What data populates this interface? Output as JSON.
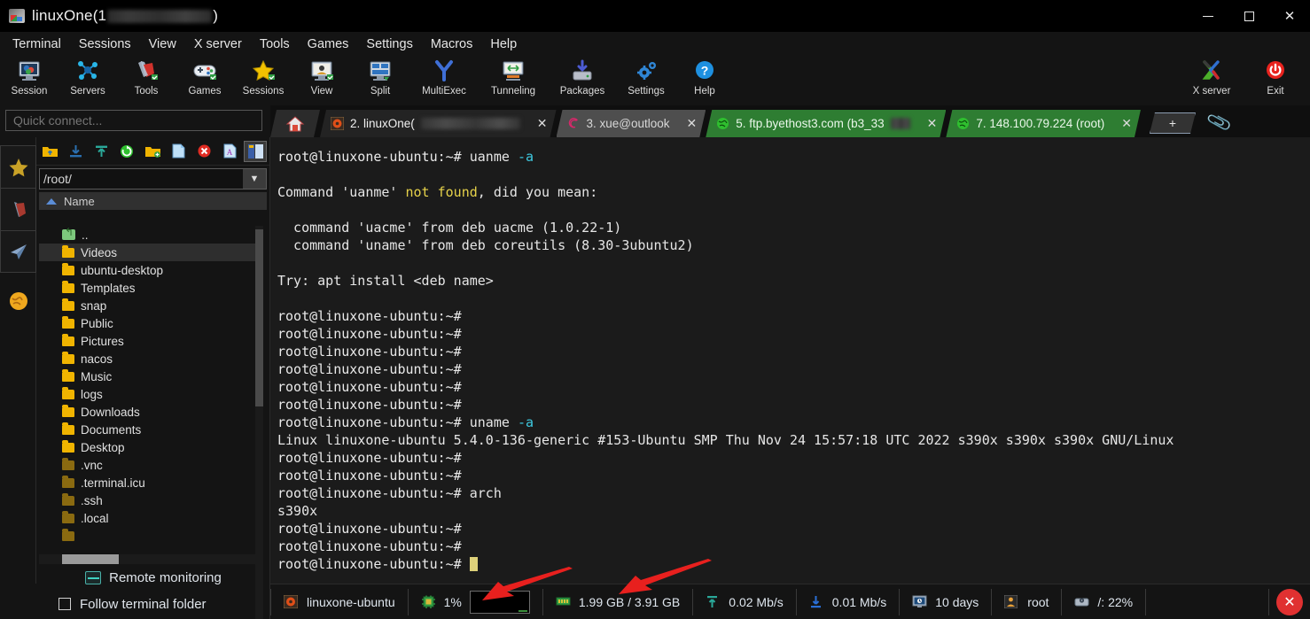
{
  "window": {
    "title_prefix": "linuxOne(1",
    "title_suffix": ")",
    "controls": {
      "minimize": "–",
      "maximize": "□",
      "close": "✕"
    }
  },
  "menubar": [
    {
      "label": "Terminal"
    },
    {
      "label": "Sessions"
    },
    {
      "label": "View"
    },
    {
      "label": "X server"
    },
    {
      "label": "Tools"
    },
    {
      "label": "Games"
    },
    {
      "label": "Settings"
    },
    {
      "label": "Macros"
    },
    {
      "label": "Help"
    }
  ],
  "toolbar": {
    "left": [
      {
        "label": "Session",
        "icon": "session-icon"
      },
      {
        "label": "Servers",
        "icon": "servers-icon"
      },
      {
        "label": "Tools",
        "icon": "swiss-knife-icon"
      },
      {
        "label": "Games",
        "icon": "gamepad-icon"
      },
      {
        "label": "Sessions",
        "icon": "star-icon"
      },
      {
        "label": "View",
        "icon": "monitor-user-icon"
      },
      {
        "label": "Split",
        "icon": "split-icon"
      },
      {
        "label": "MultiExec",
        "icon": "multiexec-icon"
      },
      {
        "label": "Tunneling",
        "icon": "tunneling-icon"
      },
      {
        "label": "Packages",
        "icon": "packages-icon"
      },
      {
        "label": "Settings",
        "icon": "gear-icon"
      },
      {
        "label": "Help",
        "icon": "help-icon"
      }
    ],
    "right": [
      {
        "label": "X server",
        "icon": "xserver-icon"
      },
      {
        "label": "Exit",
        "icon": "power-icon"
      }
    ]
  },
  "quick_connect": {
    "placeholder": "Quick connect..."
  },
  "tabs": [
    {
      "id": "home",
      "label": "",
      "icon": "home-icon",
      "state": "home",
      "closable": false
    },
    {
      "id": "t2",
      "label": "2. linuxOne(",
      "state": "active",
      "icon": "ubuntu-icon",
      "closable": true,
      "redacted": true
    },
    {
      "id": "t3",
      "label": "3. xue@outlook",
      "state": "inactive",
      "icon": "debian-icon",
      "closable": true,
      "redacted": false
    },
    {
      "id": "t5",
      "label": "5. ftp.byethost3.com (b3_33",
      "state": "green",
      "icon": "globe-icon",
      "closable": true,
      "redacted": true
    },
    {
      "id": "t7",
      "label": "7. 148.100.79.224  (root)",
      "state": "green",
      "icon": "globe-icon",
      "closable": true,
      "redacted": false
    }
  ],
  "new_tab_label": "+",
  "left_sidebar": [
    {
      "name": "sidebar-star",
      "icon": "star-icon"
    },
    {
      "name": "sidebar-tools",
      "icon": "swiss-knife-icon"
    },
    {
      "name": "sidebar-send",
      "icon": "paper-plane-icon"
    },
    {
      "name": "sidebar-globe",
      "icon": "globe-icon"
    }
  ],
  "sftp": {
    "toolbar_icons": [
      "up-folder-icon",
      "download-icon",
      "upload-icon",
      "refresh-icon",
      "new-folder-icon",
      "new-file-icon",
      "delete-icon",
      "text-mode-icon",
      "panel-view-icon"
    ],
    "path": "/root/",
    "column_header": "Name",
    "files": [
      {
        "name": "..",
        "type": "updir"
      },
      {
        "name": "Videos",
        "type": "folder",
        "selected": true
      },
      {
        "name": "ubuntu-desktop",
        "type": "folder"
      },
      {
        "name": "Templates",
        "type": "folder"
      },
      {
        "name": "snap",
        "type": "folder"
      },
      {
        "name": "Public",
        "type": "folder"
      },
      {
        "name": "Pictures",
        "type": "folder"
      },
      {
        "name": "nacos",
        "type": "folder"
      },
      {
        "name": "Music",
        "type": "folder"
      },
      {
        "name": "logs",
        "type": "folder"
      },
      {
        "name": "Downloads",
        "type": "folder"
      },
      {
        "name": "Documents",
        "type": "folder"
      },
      {
        "name": "Desktop",
        "type": "folder"
      },
      {
        "name": ".vnc",
        "type": "hidden-folder"
      },
      {
        "name": ".terminal.icu",
        "type": "hidden-folder"
      },
      {
        "name": ".ssh",
        "type": "hidden-folder"
      },
      {
        "name": ".local",
        "type": "hidden-folder"
      }
    ],
    "remote_monitoring": "Remote monitoring",
    "follow_terminal_folder": "Follow terminal folder",
    "follow_checked": false
  },
  "terminal": {
    "lines": [
      [
        {
          "t": "root@linuxone-ubuntu:~# ",
          "c": "prompt"
        },
        {
          "t": "uanme ",
          "c": "white"
        },
        {
          "t": "-a",
          "c": "cyan"
        }
      ],
      [],
      [
        {
          "t": "Command 'uanme' ",
          "c": "white"
        },
        {
          "t": "not found",
          "c": "yellow"
        },
        {
          "t": ", did you mean:",
          "c": "white"
        }
      ],
      [],
      [
        {
          "t": "  command 'uacme' from deb uacme (1.0.22-1)",
          "c": "white"
        }
      ],
      [
        {
          "t": "  command 'uname' from deb coreutils (8.30-3ubuntu2)",
          "c": "white"
        }
      ],
      [],
      [
        {
          "t": "Try: apt install <deb name>",
          "c": "white"
        }
      ],
      [],
      [
        {
          "t": "root@linuxone-ubuntu:~#",
          "c": "prompt"
        }
      ],
      [
        {
          "t": "root@linuxone-ubuntu:~#",
          "c": "prompt"
        }
      ],
      [
        {
          "t": "root@linuxone-ubuntu:~#",
          "c": "prompt"
        }
      ],
      [
        {
          "t": "root@linuxone-ubuntu:~#",
          "c": "prompt"
        }
      ],
      [
        {
          "t": "root@linuxone-ubuntu:~#",
          "c": "prompt"
        }
      ],
      [
        {
          "t": "root@linuxone-ubuntu:~#",
          "c": "prompt"
        }
      ],
      [
        {
          "t": "root@linuxone-ubuntu:~# ",
          "c": "prompt"
        },
        {
          "t": "uname ",
          "c": "white"
        },
        {
          "t": "-a",
          "c": "cyan"
        }
      ],
      [
        {
          "t": "Linux linuxone-ubuntu 5.4.0-136-generic #153-Ubuntu SMP Thu Nov 24 15:57:18 UTC 2022 s390x s390x s390x GNU/Linux",
          "c": "white"
        }
      ],
      [
        {
          "t": "root@linuxone-ubuntu:~#",
          "c": "prompt"
        }
      ],
      [
        {
          "t": "root@linuxone-ubuntu:~#",
          "c": "prompt"
        }
      ],
      [
        {
          "t": "root@linuxone-ubuntu:~# ",
          "c": "prompt"
        },
        {
          "t": "arch",
          "c": "white"
        }
      ],
      [
        {
          "t": "s390x",
          "c": "white"
        }
      ],
      [
        {
          "t": "root@linuxone-ubuntu:~#",
          "c": "prompt"
        }
      ],
      [
        {
          "t": "root@linuxone-ubuntu:~#",
          "c": "prompt"
        }
      ],
      [
        {
          "t": "root@linuxone-ubuntu:~# ",
          "c": "prompt"
        },
        {
          "t": "",
          "c": "cursor"
        }
      ]
    ]
  },
  "statusbar": {
    "cells": [
      {
        "name": "host",
        "icon": "ubuntu-icon",
        "text": "linuxone-ubuntu"
      },
      {
        "name": "cpu",
        "icon": "cpu-icon",
        "text": "1%"
      },
      {
        "name": "cpu-graph",
        "icon": "graph-box",
        "text": ""
      },
      {
        "name": "memory",
        "icon": "ram-icon",
        "text": "1.99 GB / 3.91 GB"
      },
      {
        "name": "upload",
        "icon": "upload-icon",
        "text": "0.02 Mb/s"
      },
      {
        "name": "download",
        "icon": "download-icon",
        "text": "0.01 Mb/s"
      },
      {
        "name": "uptime",
        "icon": "monitor-icon",
        "text": "10 days"
      },
      {
        "name": "user",
        "icon": "user-icon",
        "text": "root"
      },
      {
        "name": "disk",
        "icon": "disk-icon",
        "text": "/: 22%"
      }
    ],
    "close_label": "✕"
  },
  "colors": {
    "accent_green": "#2e7d32",
    "arrow_red": "#e8201e",
    "cursor_yellow": "#ded17a",
    "folder_yellow": "#f0b400",
    "terminal_bg": "#1b1b1b"
  }
}
